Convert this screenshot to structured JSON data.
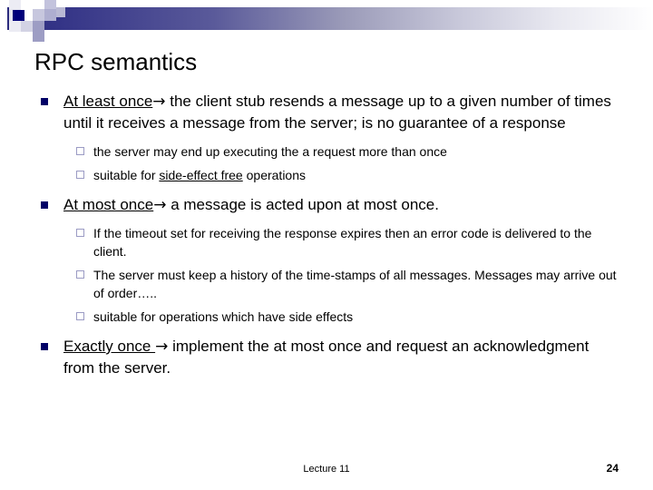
{
  "slide": {
    "title": "RPC semantics",
    "bullets": [
      {
        "level": 1,
        "underlined_lead": "At least once",
        "arrow": "→",
        "rest": " the client stub resends a message up to a given number of times until it receives a message from the server; is no guarantee of a response",
        "children": [
          {
            "level": 2,
            "text": "the server may end up executing the a request more than once"
          },
          {
            "level": 2,
            "pre": "suitable for ",
            "underlined": "side-effect free",
            "post": " operations"
          }
        ]
      },
      {
        "level": 1,
        "underlined_lead": "At most once",
        "arrow": "→",
        "rest": " a message is acted upon at most once.",
        "children": [
          {
            "level": 2,
            "text": "If the timeout set for receiving the response expires then an error code is delivered to the client."
          },
          {
            "level": 2,
            "text": "The server must keep a history of the time-stamps of all messages. Messages may arrive out of order….."
          },
          {
            "level": 2,
            "text": "suitable for operations which have side effects"
          }
        ]
      },
      {
        "level": 1,
        "underlined_lead": "Exactly once ",
        "arrow": "→",
        "rest": " implement the at most once and request an acknowledgment from the server.",
        "children": []
      }
    ]
  },
  "footer": {
    "lecture": "Lecture 11",
    "page_number": "24"
  },
  "theme": {
    "bar_start": "#2b2b7d",
    "bar_end": "#ffffff",
    "level1_bullet_color": "#000066",
    "level2_bullet_color": "#9b9bc4",
    "text_color": "#000000",
    "background": "#ffffff"
  },
  "icons": {
    "level1_bullet": "filled-square-bullet",
    "level2_bullet": "hollow-square-bullet"
  }
}
